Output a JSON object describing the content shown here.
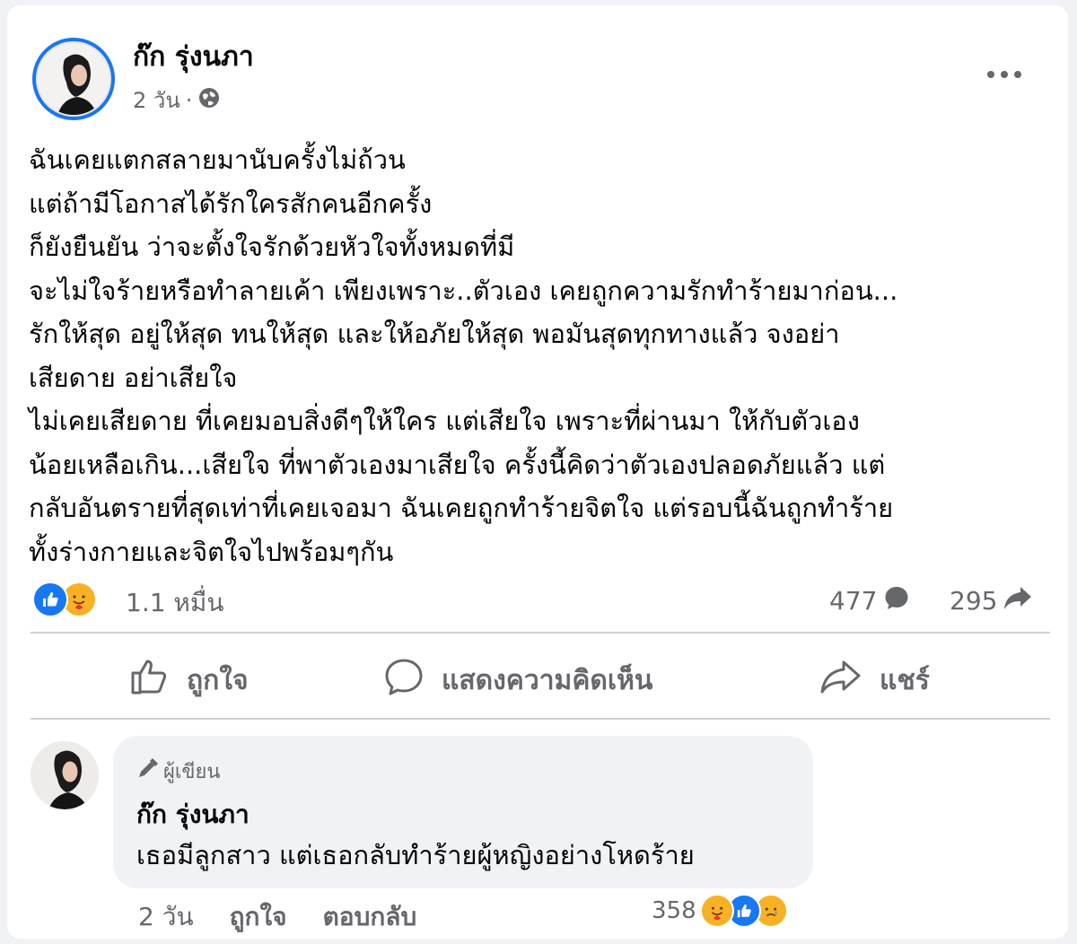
{
  "post": {
    "author": "ก๊ก รุ่งนภา",
    "time": "2 วัน",
    "separator": "·",
    "privacy_icon": "globe-icon",
    "more_icon": "more-horizontal-icon",
    "text": "ฉันเคยแตกสลายมานับครั้งไม่ถ้วน\nแต่ถ้ามีโอกาสได้รักใครสักคนอีกครั้ง\nก็ยังยืนยัน ว่าจะตั้งใจรักด้วยหัวใจทั้งหมดที่มี\nจะไม่ใจร้ายหรือทำลายเค้า เพียงเพราะ..ตัวเอง เคยถูกความรักทำร้ายมาก่อน...\nรักให้สุด อยู่ให้สุด ทนให้สุด และให้อภัยให้สุด พอมันสุดทุกทางแล้ว จงอย่า\nเสียดาย อย่าเสียใจ\nไม่เคยเสียดาย ที่เคยมอบสิ่งดีๆให้ใคร แต่เสียใจ เพราะที่ผ่านมา ให้กับตัวเอง\nน้อยเหลือเกิน...เสียใจ ที่พาตัวเองมาเสียใจ ครั้งนี้คิดว่าตัวเองปลอดภัยแล้ว แต่\nกลับอันตรายที่สุดเท่าที่เคยเจอมา ฉันเคยถูกทำร้ายจิตใจ แต่รอบนี้ฉันถูกทำร้าย\nทั้งร่างกายและจิตใจไปพร้อมๆกัน"
  },
  "stats": {
    "reaction_icons": [
      "like-icon",
      "care-icon"
    ],
    "reactions_count": "1.1 หมื่น",
    "comments_count": "477",
    "shares_count": "295"
  },
  "actions": {
    "like": "ถูกใจ",
    "comment": "แสดงความคิดเห็น",
    "share": "แชร์"
  },
  "comment": {
    "badge": "ผู้เขียน",
    "author": "ก๊ก รุ่งนภา",
    "text": "เธอมีลูกสาว แต่เธอกลับทำร้ายผู้หญิงอย่างโหดร้าย",
    "time": "2 วัน",
    "like_label": "ถูกใจ",
    "reply_label": "ตอบกลับ",
    "reactions_count": "358",
    "reaction_icons": [
      "care-icon",
      "like-icon",
      "sad-icon"
    ]
  },
  "colors": {
    "accent": "#1877f2",
    "secondary_text": "#65676b",
    "divider": "#ced0d4",
    "comment_bg": "#f0f2f5"
  }
}
